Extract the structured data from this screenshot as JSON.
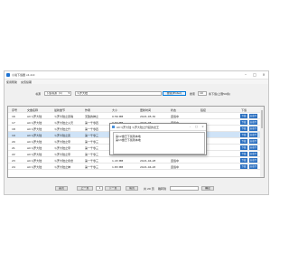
{
  "window": {
    "title": "小说下载器 v1.0.0"
  },
  "menu": [
    "使用帮助",
    "充值续期"
  ],
  "search": {
    "source_label": "书源",
    "source_value": "下载书源（1）",
    "query_value": "斗罗大陆",
    "search_button": "搜索(Enter)",
    "count_label": "搜索",
    "count_value": "10",
    "count_suffix": "条下载(上限50条)"
  },
  "table": {
    "headers": [
      "序号",
      "文章名称",
      "最新章节",
      "作者",
      "大小",
      "更新时间",
      "状态",
      "链接",
      "下载"
    ],
    "rows": [
      [
        "16",
        "AC斗罗大陆",
        "斗罗大陆之武魂",
        "无敌的神之",
        "不知道作",
        "0.56 MB",
        "2021-05-30",
        "连载中"
      ],
      [
        "17",
        "AC斗罗大陆",
        "斗罗大陆之火灵",
        "第一千零四",
        "不知道作",
        "0.87 MB",
        "2021-05-",
        "连载中"
      ],
      [
        "18",
        "AC斗罗大陆",
        "斗罗大陆之升",
        "第一千零四",
        "",
        "",
        "",
        ""
      ],
      [
        "19",
        "AC斗罗大陆",
        "斗罗大陆之武",
        "第一千零三",
        "",
        "",
        "",
        ""
      ],
      [
        "20",
        "AC斗罗大陆",
        "斗罗大陆之帝",
        "第一千零三",
        "",
        "",
        "",
        ""
      ],
      [
        "21",
        "AC斗罗大陆",
        "斗罗大陆之帝",
        "第一千零三",
        "",
        "",
        "",
        ""
      ],
      [
        "22",
        "AC斗罗大陆",
        "斗罗大陆之帝",
        "第一千零三",
        "",
        "",
        "",
        ""
      ],
      [
        "23",
        "AC斗罗大陆",
        "斗罗大陆之永世",
        "第一千零三",
        "不知道作",
        "1.43 MB",
        "2021-04-28",
        "连载中"
      ],
      [
        "24",
        "AC斗罗大陆",
        "斗罗大陆之神",
        "第一千零三",
        "不知道作",
        "1.83 MB",
        "2021-04-26",
        "连载中"
      ]
    ],
    "download_label": "下载",
    "download_alt_label": "分章下"
  },
  "dialog": {
    "title": "AC斗罗大陆 斗罗大陆之升起的龙王",
    "lines": [
      "第12章已下载到本地",
      "第13章已下载到本地"
    ]
  },
  "pager": {
    "first": "首页",
    "prev": "上一页",
    "page": "1",
    "next": "下一页",
    "last": "尾页",
    "total": "共 20 页",
    "jump_label": "跳转到",
    "go": "确定"
  }
}
